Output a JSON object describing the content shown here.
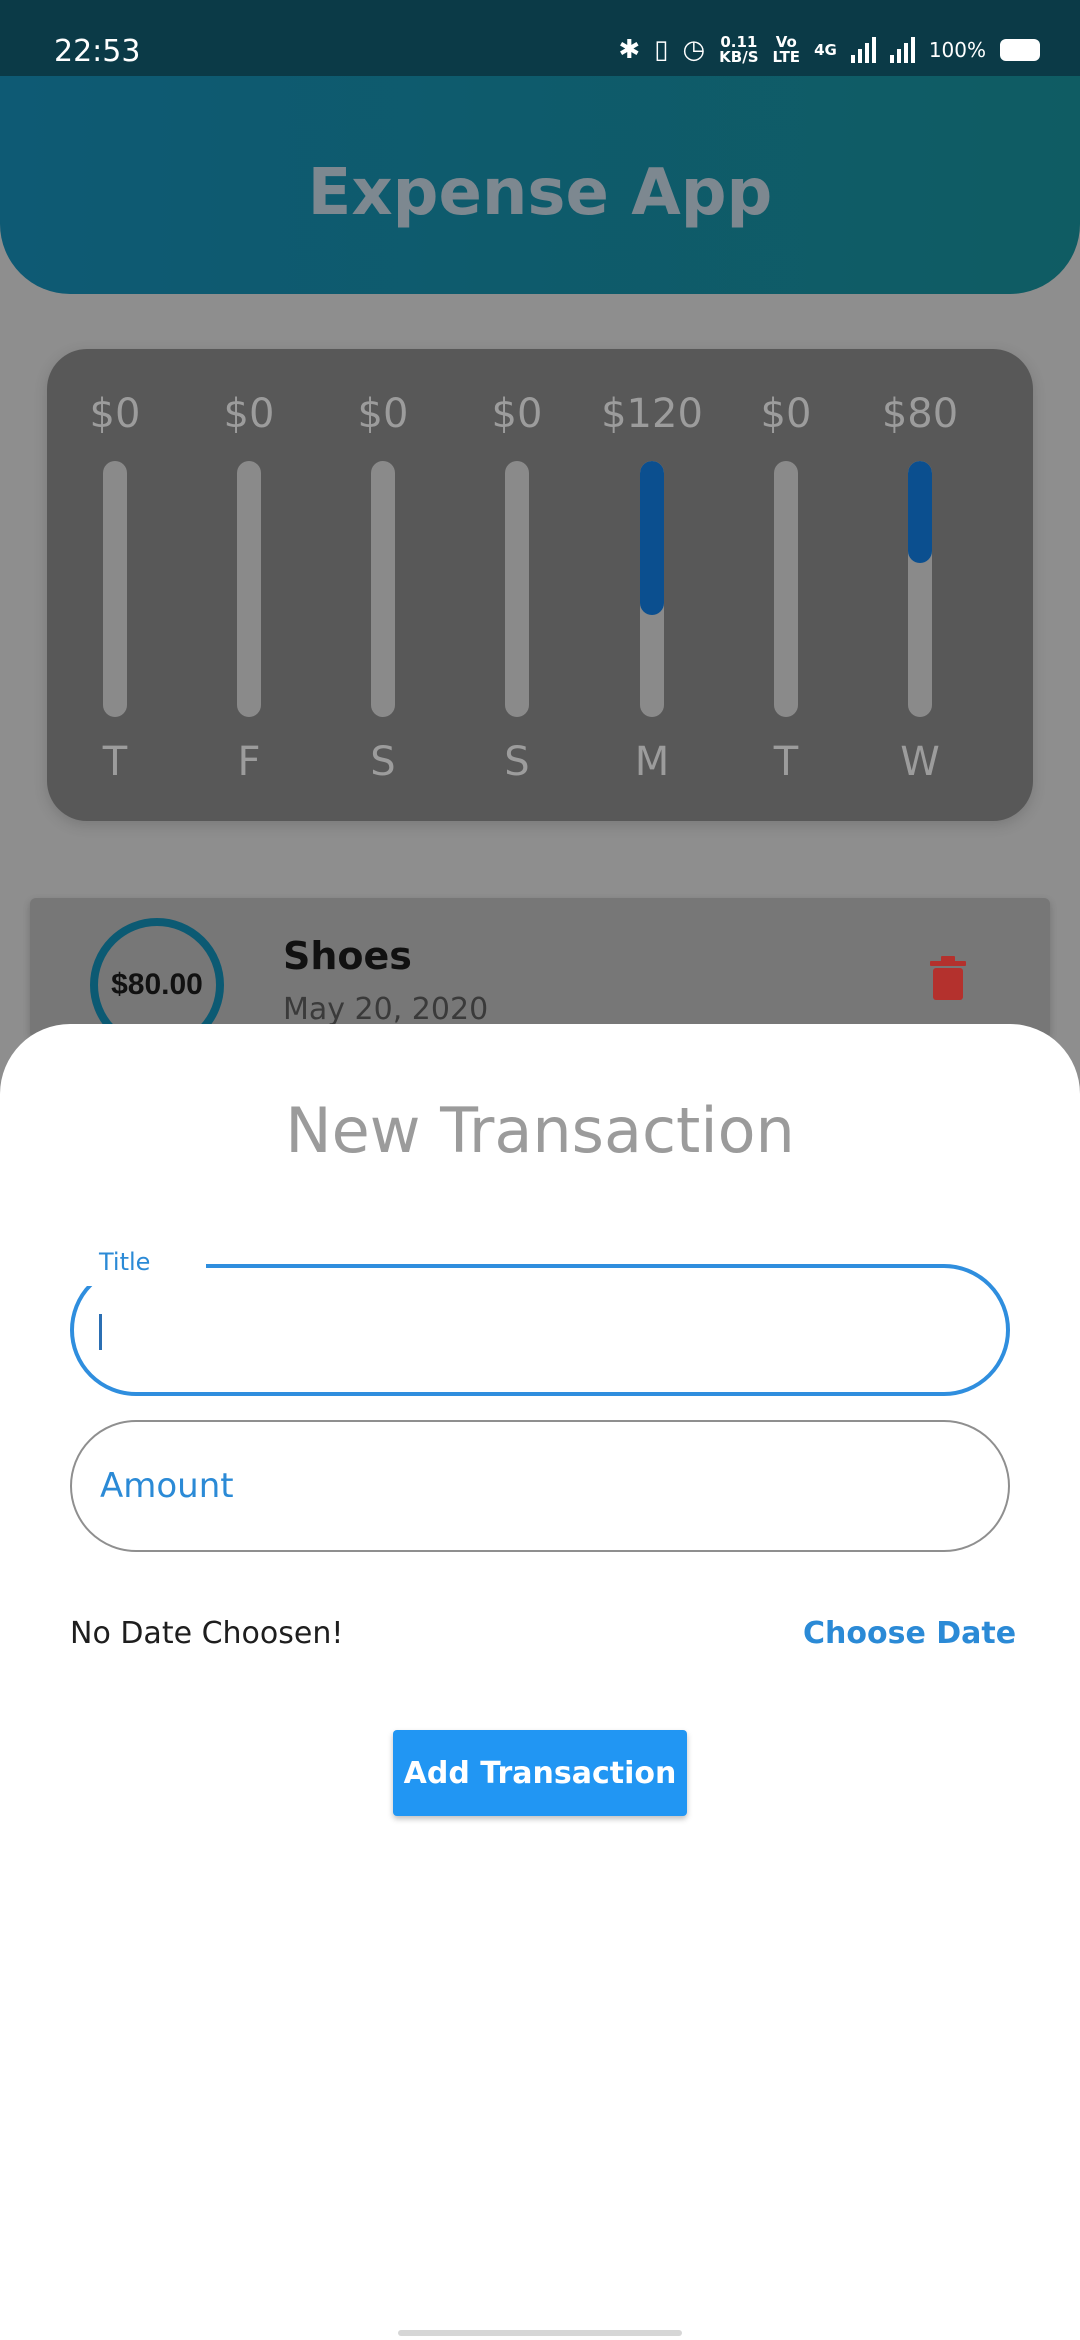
{
  "status_bar": {
    "time": "22:53",
    "data_speed_value": "0.11",
    "data_speed_unit": "KB/S",
    "volte_top": "Vo",
    "volte_bottom": "LTE",
    "network_type": "4G",
    "battery": "100%"
  },
  "app": {
    "title": "Expense App",
    "header_gradient": [
      "#0e5a74",
      "#0f5c63"
    ]
  },
  "chart_data": {
    "type": "bar",
    "categories": [
      "T",
      "F",
      "S",
      "S",
      "M",
      "T",
      "W"
    ],
    "values": [
      0,
      0,
      0,
      0,
      120,
      0,
      80
    ],
    "value_labels": [
      "$0",
      "$0",
      "$0",
      "$0",
      "$120",
      "$0",
      "$80"
    ],
    "fill_fraction": [
      0,
      0,
      0,
      0,
      0.6,
      0,
      0.4
    ],
    "orientation": "vertical",
    "bar_fill_direction": "top-down"
  },
  "transaction": {
    "amount": "$80.00",
    "title": "Shoes",
    "date": "May 20, 2020",
    "delete_icon": "trash-icon",
    "delete_color": "#b4312d"
  },
  "sheet": {
    "title": "New Transaction",
    "title_field_label": "Title",
    "amount_placeholder": "Amount",
    "date_status": "No Date Choosen!",
    "choose_date_label": "Choose Date",
    "submit_label": "Add Transaction"
  },
  "colors": {
    "accent": "#2196f3",
    "accent_text": "#2b8ad6",
    "bar_fill": "#0b4f8f"
  }
}
